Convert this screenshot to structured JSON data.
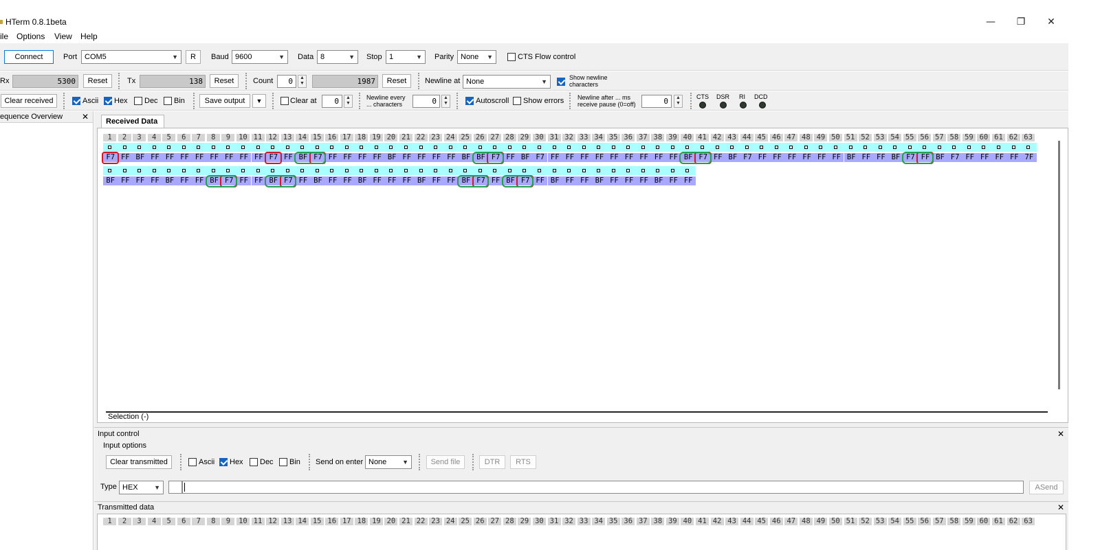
{
  "window": {
    "title": "HTerm 0.8.1beta",
    "minimize": "—",
    "restore": "❐",
    "close": "✕"
  },
  "menu": [
    "ile",
    "Options",
    "View",
    "Help"
  ],
  "toolbar1": {
    "connect": "Connect",
    "port_label": "Port",
    "port": "COM5",
    "r_button": "R",
    "baud_label": "Baud",
    "baud": "9600",
    "data_label": "Data",
    "data_bits": "8",
    "stop_label": "Stop",
    "stop_bits": "1",
    "parity_label": "Parity",
    "parity": "None",
    "cts_flow": "CTS Flow control"
  },
  "toolbar2": {
    "rx_label": "Rx",
    "rx_value": "5300",
    "rx_reset": "Reset",
    "tx_label": "Tx",
    "tx_value": "138",
    "tx_reset": "Reset",
    "count_label": "Count",
    "count_value": "0",
    "count_field": "1987",
    "count_reset": "Reset",
    "newline_label": "Newline at",
    "newline_value": "None",
    "show_newline": "Show newline characters"
  },
  "toolbar3": {
    "clear_received": "Clear received",
    "ascii": "Ascii",
    "hex": "Hex",
    "dec": "Dec",
    "bin": "Bin",
    "save_output": "Save output",
    "clear_at": "Clear at",
    "clear_at_value": "0",
    "newline_every": "Newline every ... characters",
    "newline_every_value": "0",
    "autoscroll": "Autoscroll",
    "show_errors": "Show errors",
    "newline_after": "Newline after ... ms receive pause (0=off)",
    "newline_after_value": "0",
    "leds": [
      "CTS",
      "DSR",
      "RI",
      "DCD"
    ]
  },
  "sequence_overview": {
    "title": "equence Overview",
    "close": "✕"
  },
  "received": {
    "tab": "Received Data",
    "selection": "Selection (-)",
    "columns": [
      "1",
      "2",
      "3",
      "4",
      "5",
      "6",
      "7",
      "8",
      "9",
      "10",
      "11",
      "12",
      "13",
      "14",
      "15",
      "16",
      "17",
      "18",
      "19",
      "20",
      "21",
      "22",
      "23",
      "24",
      "25",
      "26",
      "27",
      "28",
      "29",
      "30",
      "31",
      "32",
      "33",
      "34",
      "35",
      "36",
      "37",
      "38",
      "39",
      "40",
      "41",
      "42",
      "43",
      "44",
      "45",
      "46",
      "47",
      "48",
      "49",
      "50",
      "51",
      "52",
      "53",
      "54",
      "55",
      "56",
      "57",
      "58",
      "59",
      "60",
      "61",
      "62",
      "63"
    ],
    "row1": [
      "F7",
      "FF",
      "BF",
      "FF",
      "FF",
      "FF",
      "FF",
      "FF",
      "FF",
      "FF",
      "FF",
      "F7",
      "FF",
      "BF",
      "F7",
      "FF",
      "FF",
      "FF",
      "FF",
      "BF",
      "FF",
      "FF",
      "FF",
      "FF",
      "BF",
      "BF",
      "F7",
      "FF",
      "BF",
      "F7",
      "FF",
      "FF",
      "FF",
      "FF",
      "FF",
      "FF",
      "FF",
      "FF",
      "FF",
      "BF",
      "F7",
      "FF",
      "BF",
      "F7",
      "FF",
      "FF",
      "FF",
      "FF",
      "FF",
      "FF",
      "BF",
      "FF",
      "FF",
      "BF",
      "F7",
      "FF",
      "BF",
      "F7",
      "FF",
      "FF",
      "FF",
      "FF",
      "7F"
    ],
    "row2": [
      "BF",
      "FF",
      "FF",
      "FF",
      "BF",
      "FF",
      "FF",
      "BF",
      "F7",
      "FF",
      "FF",
      "BF",
      "F7",
      "FF",
      "BF",
      "FF",
      "FF",
      "BF",
      "FF",
      "FF",
      "FF",
      "BF",
      "FF",
      "FF",
      "BF",
      "F7",
      "FF",
      "BF",
      "F7",
      "FF",
      "BF",
      "FF",
      "FF",
      "BF",
      "FF",
      "FF",
      "FF",
      "BF",
      "FF",
      "FF"
    ]
  },
  "input_control": {
    "title": "Input control",
    "close": "✕",
    "options_title": "Input options",
    "clear_transmitted": "Clear transmitted",
    "ascii": "Ascii",
    "hex": "Hex",
    "dec": "Dec",
    "bin": "Bin",
    "send_on_enter_label": "Send on enter",
    "send_on_enter": "None",
    "send_file": "Send file",
    "dtr": "DTR",
    "rts": "RTS",
    "type_label": "Type",
    "type_value": "HEX",
    "asend": "ASend"
  },
  "transmitted": {
    "title": "Transmitted data",
    "close": "✕"
  }
}
